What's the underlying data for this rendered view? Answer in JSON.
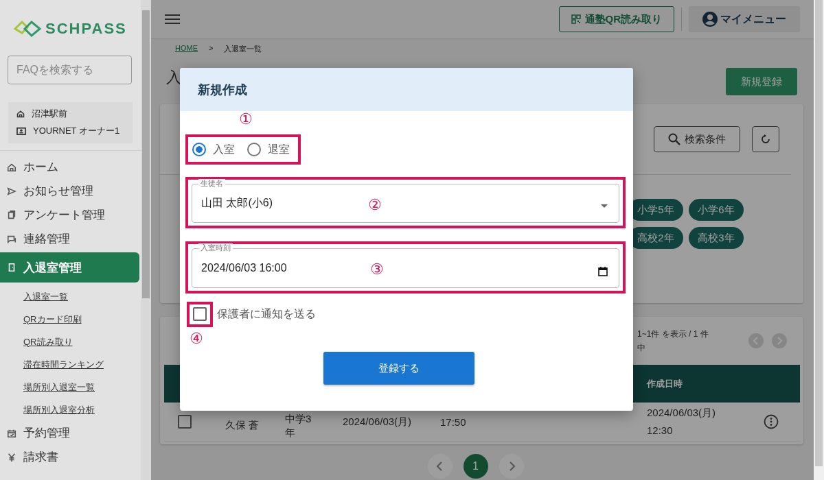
{
  "sidebar": {
    "logo": "SCHPASS",
    "faq_search": {
      "placeholder": "FAQを検索する"
    },
    "school": "沼津駅前",
    "user": "YOURNET オーナー1",
    "nav": [
      {
        "label": "ホーム",
        "selected": false
      },
      {
        "label": "お知らせ管理",
        "selected": false
      },
      {
        "label": "アンケート管理",
        "selected": false
      },
      {
        "label": "連絡管理",
        "selected": false
      },
      {
        "label": "入退室管理",
        "selected": true,
        "children": [
          {
            "label": "入退室一覧"
          },
          {
            "label": "QRカード印刷"
          },
          {
            "label": "QR読み取り"
          },
          {
            "label": "滞在時間ランキング"
          },
          {
            "label": "場所別入退室一覧"
          },
          {
            "label": "場所別入退室分析"
          }
        ]
      },
      {
        "label": "予約管理",
        "selected": false
      },
      {
        "label": "請求書",
        "selected": false
      }
    ]
  },
  "topbar": {
    "qr_button": "通塾QR読み取り",
    "my_menu": "マイメニュー"
  },
  "breadcrumb": {
    "items": [
      "HOME",
      "入退室一覧"
    ],
    "separator": ">"
  },
  "page": {
    "title": "入",
    "new_button": "新規登録"
  },
  "filter": {
    "search_button": "検索条件",
    "chips": [
      "小学5年",
      "小学6年",
      "高校2年",
      "高校3年"
    ]
  },
  "table": {
    "count": "1~1件 を表示 / 1 件中",
    "columns": [
      "作成日時"
    ],
    "rows": [
      {
        "checked": false,
        "name": "久保 蒼",
        "grade": "中学3年",
        "date": "2024/06/03(月)",
        "time": "17:50",
        "created": "2024/06/03(月) 12:30"
      }
    ]
  },
  "pagination": {
    "pages": [
      {
        "label": "1",
        "selected": true
      }
    ]
  },
  "modal": {
    "title": "新規作成",
    "direction": [
      {
        "label": "入室",
        "selected": true
      },
      {
        "label": "退室",
        "selected": false
      }
    ],
    "student": {
      "label": "生徒名",
      "value": "山田 太郎(小6)"
    },
    "time": {
      "label": "入室時刻",
      "value": "2024/06/03 16:00"
    },
    "notify": {
      "label": "保護者に通知を送る",
      "checked": false
    },
    "submit": "登録する"
  },
  "annotations": [
    "①",
    "②",
    "③",
    "④"
  ]
}
